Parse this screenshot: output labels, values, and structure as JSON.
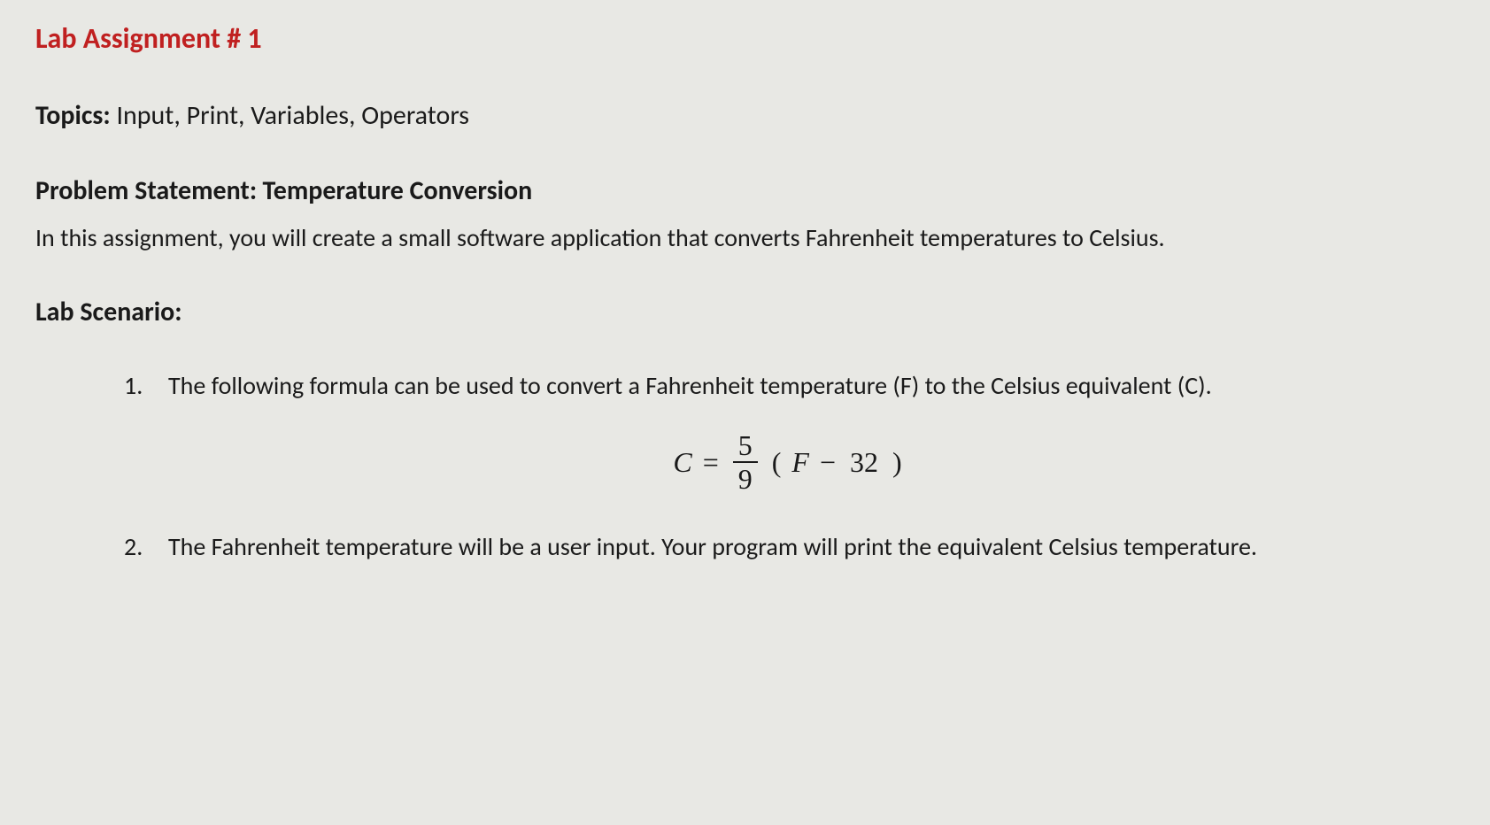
{
  "title": "Lab Assignment # 1",
  "topics": {
    "label": "Topics:",
    "value": "Input, Print, Variables, Operators"
  },
  "problem": {
    "label": "Problem Statement:",
    "title": "Temperature Conversion",
    "description": "In this assignment, you will create a small software application that converts Fahrenheit temperatures to Celsius."
  },
  "scenario": {
    "label": "Lab Scenario:",
    "items": [
      {
        "num": "1.",
        "text": "The following formula can be used to convert a Fahrenheit temperature (F) to the Celsius equivalent (C)."
      },
      {
        "num": "2.",
        "text": "The Fahrenheit temperature will be a user input. Your program will print the equivalent Celsius temperature."
      }
    ]
  },
  "formula": {
    "lhs": "C",
    "eq": "=",
    "frac_num": "5",
    "frac_den": "9",
    "lparen": "(",
    "var": "F",
    "minus": "−",
    "const": "32",
    "rparen": ")"
  }
}
